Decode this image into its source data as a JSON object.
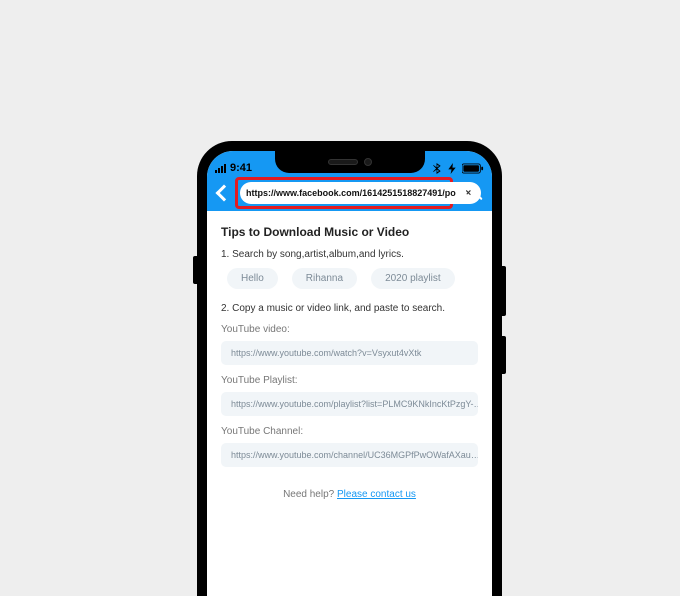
{
  "statusbar": {
    "time": "9:41"
  },
  "navbar": {
    "url_value": "https://www.facebook.com/1614251518827491/po"
  },
  "page": {
    "title": "Tips to Download Music or Video",
    "step1_text": "1. Search by song,artist,album,and lyrics.",
    "chips": [
      "Hello",
      "Rihanna",
      "2020 playlist"
    ],
    "step2_text": "2. Copy a music or video link, and paste to search.",
    "examples": [
      {
        "label": "YouTube video:",
        "value": "https://www.youtube.com/watch?v=Vsyxut4vXtk"
      },
      {
        "label": "YouTube Playlist:",
        "value": "https://www.youtube.com/playlist?list=PLMC9KNkIncKtPzgY-…"
      },
      {
        "label": "YouTube Channel:",
        "value": "https://www.youtube.com/channel/UC36MGPfPwOWafAXau…"
      }
    ],
    "help_prefix": "Need help? ",
    "help_link": "Please contact us"
  }
}
